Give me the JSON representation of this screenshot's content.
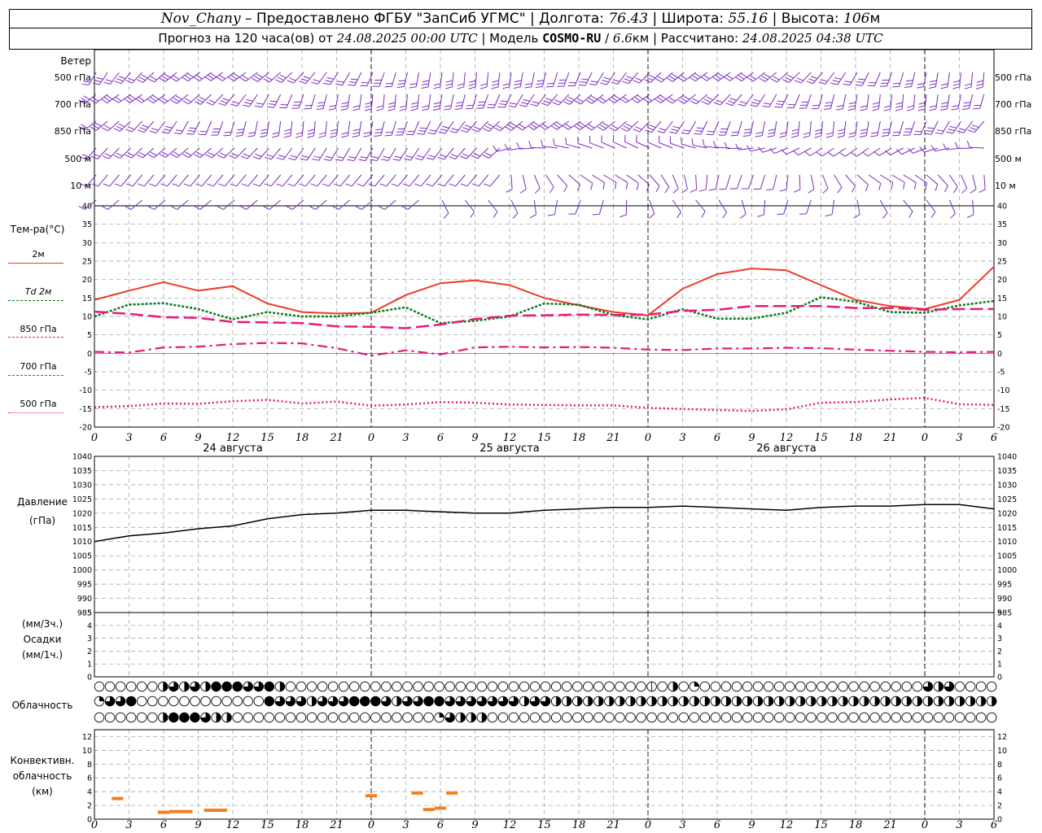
{
  "header": {
    "station": "Nov_Chany",
    "provider_prefix": " – Предоставлено ФГБУ \"ЗапСиб УГМС\" | Долгота: ",
    "longitude": "76.43",
    "lat_label": " | Широта: ",
    "latitude": "55.16",
    "alt_label": " | Высота: ",
    "altitude": "106",
    "alt_unit": "м",
    "forecast_prefix": "Прогноз на 120 часа(ов) от ",
    "forecast_start": "24.08.2025 00:00 UTC",
    "model_label": " | Модель ",
    "model_name": "COSMO-RU",
    "model_sep": " / ",
    "resolution": "6.6",
    "resolution_unit": "км",
    "calc_label": " | Рассчитано: ",
    "calc_time": "24.08.2025 04:38 UTC"
  },
  "labels": {
    "wind": "Ветер",
    "wind_levels": [
      "500 гПа",
      "700 гПа",
      "850 гПа",
      "500 м",
      "10 м"
    ],
    "temp": "Тем-ра(°C)",
    "temp_legend": [
      "2м",
      "Td 2м",
      "850 гПа",
      "700 гПа",
      "500 гПа"
    ],
    "pressure": "Давление",
    "pressure_unit": "(гПа)",
    "precip_3h": "(мм/3ч.)",
    "precip": "Осадки",
    "precip_1h": "(мм/1ч.)",
    "cloud": "Облачность",
    "conv1": "Конвективн.",
    "conv2": "облачность",
    "conv3": "(км)"
  },
  "colors": {
    "wind": "#7b2cbf",
    "t2m": "#ee3a2a",
    "td2m": "#0a7a1a",
    "t850": "#e8197a",
    "t700": "#e8197a",
    "t500": "#e8197a",
    "pressure": "#000000",
    "convective": "#f08020",
    "grid": "#9a9a9a"
  },
  "chart_data": [
    {
      "type": "line",
      "panel": "temperature",
      "ylabel": "Тем-ра(°C)",
      "ylim": [
        -20,
        40
      ],
      "ticks": [
        -20,
        -15,
        -10,
        -5,
        0,
        5,
        10,
        15,
        20,
        25,
        30,
        35,
        40
      ],
      "x_hours": [
        0,
        3,
        6,
        9,
        12,
        15,
        18,
        21,
        24,
        27,
        30,
        33,
        36,
        39,
        42,
        45,
        48,
        51,
        54,
        57,
        60,
        63,
        66,
        69,
        72,
        75,
        78
      ],
      "x_tick_labels": [
        "0",
        "3",
        "6",
        "9",
        "12",
        "15",
        "18",
        "21",
        "0",
        "3",
        "6",
        "9",
        "12",
        "15",
        "18",
        "21",
        "0",
        "3",
        "6",
        "9",
        "12",
        "15",
        "18",
        "21",
        "0",
        "3",
        "6"
      ],
      "day_labels": [
        "24 августа",
        "25 августа",
        "26 августа"
      ],
      "series": [
        {
          "name": "2м",
          "values": [
            14.5,
            17,
            19.3,
            17,
            18.2,
            13.5,
            11.2,
            10.8,
            11,
            15.8,
            19,
            19.8,
            18.5,
            15,
            13,
            11.2,
            10.3,
            17.5,
            21.5,
            23,
            22.5,
            18.5,
            14.5,
            12.8,
            12,
            14.5,
            23.5
          ]
        },
        {
          "name": "Td 2м",
          "values": [
            10,
            13.2,
            13.6,
            12,
            9.2,
            11.2,
            10,
            10,
            11,
            12.5,
            8.2,
            8.8,
            10,
            13.5,
            13.2,
            10.4,
            9.2,
            12,
            9.4,
            9.4,
            11,
            15.2,
            14,
            11.2,
            11,
            13,
            14.2
          ]
        },
        {
          "name": "850 гПа",
          "values": [
            11.3,
            10.7,
            9.8,
            9.6,
            8.5,
            8.4,
            8.2,
            7.3,
            7.2,
            6.8,
            7.8,
            9.3,
            10.2,
            10.3,
            10.5,
            10.4,
            10.5,
            11.5,
            11.8,
            12.8,
            12.8,
            12.8,
            12.3,
            12.3,
            11.8,
            12,
            12
          ]
        },
        {
          "name": "700 гПа",
          "values": [
            0.4,
            0.2,
            1.6,
            1.8,
            2.5,
            2.8,
            2.7,
            1.4,
            -0.6,
            0.8,
            -0.3,
            1.6,
            1.8,
            1.6,
            1.7,
            1.5,
            1,
            0.9,
            1.3,
            1.3,
            1.5,
            1.4,
            1,
            0.7,
            0.4,
            0.3,
            0.4
          ]
        },
        {
          "name": "500 гПа",
          "values": [
            -14.6,
            -14.3,
            -13.6,
            -13.7,
            -13,
            -12.6,
            -13.6,
            -13.1,
            -14.2,
            -13.9,
            -13.2,
            -13.4,
            -13.9,
            -14,
            -14.1,
            -14.1,
            -14.8,
            -15.1,
            -15.4,
            -15.6,
            -15.2,
            -13.4,
            -13.2,
            -12.5,
            -12.1,
            -13.8,
            -14
          ]
        }
      ]
    },
    {
      "type": "line",
      "panel": "pressure",
      "ylabel": "Давление (гПа)",
      "ylim": [
        985,
        1040
      ],
      "ticks": [
        985,
        990,
        995,
        1000,
        1005,
        1010,
        1015,
        1020,
        1025,
        1030,
        1035,
        1040
      ],
      "x_hours": [
        0,
        3,
        6,
        9,
        12,
        15,
        18,
        21,
        24,
        27,
        30,
        33,
        36,
        39,
        42,
        45,
        48,
        51,
        54,
        57,
        60,
        63,
        66,
        69,
        72,
        75,
        78
      ],
      "series": [
        {
          "name": "Давление",
          "values": [
            1010,
            1012,
            1013,
            1014.5,
            1015.5,
            1018,
            1019.5,
            1020,
            1021,
            1021,
            1020.5,
            1020,
            1020,
            1021,
            1021.5,
            1022,
            1022,
            1022.5,
            1022,
            1021.5,
            1021,
            1022,
            1022.5,
            1022.5,
            1023,
            1023,
            1021.5
          ]
        }
      ]
    },
    {
      "type": "line",
      "panel": "precipitation",
      "ylabel": "Осадки",
      "ylim": [
        0,
        5
      ],
      "ticks": [
        0,
        1,
        2,
        3,
        4,
        5
      ],
      "series": [
        {
          "name": "Осадки",
          "values": []
        }
      ]
    },
    {
      "type": "table",
      "panel": "cloudiness",
      "rows": [
        {
          "level": "верхний",
          "octas": [
            0,
            0,
            0,
            0,
            0,
            0,
            4,
            6,
            4,
            6,
            4,
            8,
            8,
            8,
            7,
            6,
            8,
            4,
            0,
            0,
            0,
            0,
            0,
            0,
            0,
            0,
            0,
            0,
            0,
            0,
            0,
            0,
            0,
            0,
            0,
            0,
            0,
            0,
            0,
            0,
            0,
            0,
            0,
            0,
            0,
            0,
            0,
            0,
            0,
            0,
            0,
            0,
            1,
            0,
            4,
            0,
            2,
            0,
            0,
            0,
            0,
            0,
            0,
            0,
            0,
            0,
            0,
            0,
            0,
            0,
            0,
            0,
            0,
            0,
            0,
            0,
            0,
            0,
            7,
            4,
            6,
            0,
            0,
            0,
            0,
            0
          ]
        },
        {
          "level": "средний",
          "octas": [
            2,
            6,
            6,
            8,
            0,
            0,
            0,
            0,
            0,
            0,
            0,
            0,
            0,
            0,
            0,
            0,
            8,
            6,
            6,
            6,
            5,
            6,
            6,
            6,
            8,
            8,
            8,
            6,
            4,
            6,
            6,
            8,
            8,
            7,
            6,
            7,
            6,
            6,
            6,
            6,
            4,
            6,
            6,
            5,
            4,
            4,
            4,
            4,
            4,
            4,
            4,
            4,
            4,
            4,
            4,
            4,
            4,
            4,
            4,
            4,
            4,
            4,
            4,
            4,
            4,
            4,
            4,
            4,
            4,
            4,
            4,
            4,
            4,
            4,
            4,
            4,
            4,
            4,
            4,
            4,
            4,
            4,
            4,
            4,
            4,
            4
          ]
        },
        {
          "level": "нижний",
          "octas": [
            0,
            0,
            0,
            0,
            0,
            0,
            4,
            8,
            8,
            8,
            6,
            4,
            4,
            0,
            0,
            0,
            0,
            0,
            0,
            0,
            0,
            0,
            0,
            0,
            0,
            0,
            0,
            0,
            0,
            0,
            0,
            0,
            2,
            6,
            4,
            4,
            4,
            0,
            0,
            0,
            0,
            0,
            0,
            0,
            0,
            0,
            0,
            0,
            0,
            0,
            0,
            0,
            0,
            0,
            0,
            0,
            0,
            0,
            0,
            0,
            0,
            0,
            0,
            0,
            0,
            0,
            0,
            0,
            0,
            0,
            0,
            0,
            0,
            0,
            0,
            0,
            0,
            0,
            0,
            0,
            0,
            0,
            0,
            0,
            0,
            0
          ]
        }
      ]
    },
    {
      "type": "bar",
      "panel": "convective",
      "ylabel": "Конвективн. облачность (км)",
      "ylim": [
        0,
        13
      ],
      "ticks": [
        0,
        2,
        4,
        6,
        8,
        10,
        12
      ],
      "segments": [
        {
          "from_hour": 1.5,
          "to_hour": 2.5,
          "base_km": 3.0
        },
        {
          "from_hour": 5.5,
          "to_hour": 6.5,
          "base_km": 1.0
        },
        {
          "from_hour": 6.5,
          "to_hour": 8.5,
          "base_km": 1.1
        },
        {
          "from_hour": 9.5,
          "to_hour": 11.5,
          "base_km": 1.3
        },
        {
          "from_hour": 23.5,
          "to_hour": 24.5,
          "base_km": 3.4
        },
        {
          "from_hour": 27.5,
          "to_hour": 28.5,
          "base_km": 3.8
        },
        {
          "from_hour": 28.5,
          "to_hour": 29.5,
          "base_km": 1.4
        },
        {
          "from_hour": 29.5,
          "to_hour": 30.5,
          "base_km": 1.6
        },
        {
          "from_hour": 30.5,
          "to_hour": 31.5,
          "base_km": 3.8
        }
      ]
    }
  ]
}
